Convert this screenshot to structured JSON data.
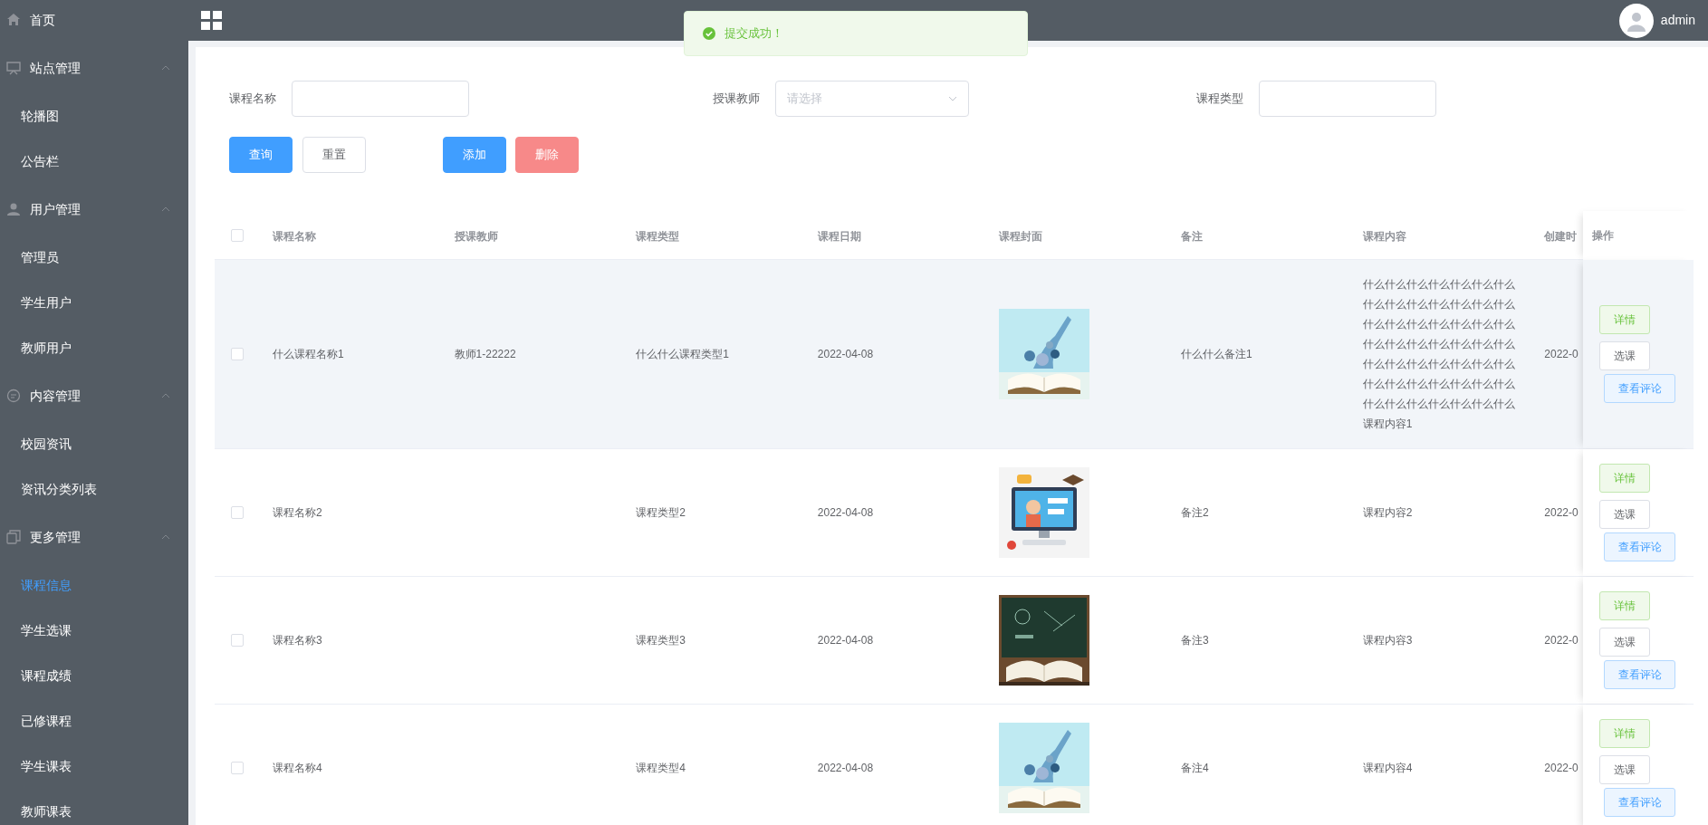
{
  "sidebar": {
    "items": [
      {
        "kind": "link",
        "label": "首页"
      },
      {
        "kind": "group",
        "label": "站点管理",
        "expanded": true,
        "children": [
          {
            "label": "轮播图",
            "selected": false
          },
          {
            "label": "公告栏",
            "selected": false
          }
        ]
      },
      {
        "kind": "group",
        "label": "用户管理",
        "expanded": true,
        "children": [
          {
            "label": "管理员",
            "selected": false
          },
          {
            "label": "学生用户",
            "selected": false
          },
          {
            "label": "教师用户",
            "selected": false
          }
        ]
      },
      {
        "kind": "group",
        "label": "内容管理",
        "expanded": true,
        "children": [
          {
            "label": "校园资讯",
            "selected": false
          },
          {
            "label": "资讯分类列表",
            "selected": false
          }
        ]
      },
      {
        "kind": "group",
        "label": "更多管理",
        "expanded": true,
        "children": [
          {
            "label": "课程信息",
            "selected": true
          },
          {
            "label": "学生选课",
            "selected": false
          },
          {
            "label": "课程成绩",
            "selected": false
          },
          {
            "label": "已修课程",
            "selected": false
          },
          {
            "label": "学生课表",
            "selected": false
          },
          {
            "label": "教师课表",
            "selected": false
          }
        ]
      }
    ]
  },
  "header": {
    "user": "admin"
  },
  "toast": {
    "message": "提交成功！"
  },
  "filters": [
    {
      "kind": "input",
      "label": "课程名称"
    },
    {
      "kind": "select",
      "label": "授课教师",
      "placeholder": "请选择"
    },
    {
      "kind": "input",
      "label": "课程类型"
    }
  ],
  "buttons": [
    {
      "kind": "primary",
      "label": "查询"
    },
    {
      "kind": "default",
      "label": "重置"
    },
    {
      "kind": "primary",
      "label": "添加"
    },
    {
      "kind": "danger",
      "label": "删除"
    }
  ],
  "table": {
    "all_checked": false,
    "columns": [
      "课程名称",
      "授课教师",
      "课程类型",
      "课程日期",
      "课程封面",
      "备注",
      "课程内容",
      "创建时",
      "操作"
    ],
    "rows": [
      {
        "checked": false,
        "highlighted": true,
        "name": "什么课程名称1",
        "teacher": "教师1-22222",
        "type": "什么什么课程类型1",
        "date": "2022-04-08",
        "cover": {
          "kind": "picture"
        },
        "note": "什么什么备注1",
        "content": "什么什么什么什么什么什么什么什么什么什么什么什么什么什么什么什么什么什么什么什么什么什么什么什么什么什么什么什么什么什么什么什么什么什么什么什么什么什么什么什么什么什么什么什么什么什么什么什么什么课程内容1",
        "created": "2022-0",
        "actions": [
          "详情",
          "选课",
          "查看评论"
        ]
      },
      {
        "checked": false,
        "highlighted": false,
        "name": "课程名称2",
        "type": "课程类型2",
        "date": "2022-04-08",
        "cover": {
          "kind": "picture"
        },
        "note": "备注2",
        "content": "课程内容2",
        "created": "2022-0",
        "actions": [
          "详情",
          "选课",
          "查看评论"
        ]
      },
      {
        "checked": false,
        "highlighted": false,
        "name": "课程名称3",
        "type": "课程类型3",
        "date": "2022-04-08",
        "cover": {
          "kind": "picture"
        },
        "note": "备注3",
        "content": "课程内容3",
        "created": "2022-0",
        "actions": [
          "详情",
          "选课",
          "查看评论"
        ]
      },
      {
        "checked": false,
        "highlighted": false,
        "name": "课程名称4",
        "type": "课程类型4",
        "date": "2022-04-08",
        "cover": {
          "kind": "picture"
        },
        "note": "备注4",
        "content": "课程内容4",
        "created": "2022-0",
        "actions": [
          "详情",
          "选课",
          "查看评论"
        ]
      }
    ]
  }
}
